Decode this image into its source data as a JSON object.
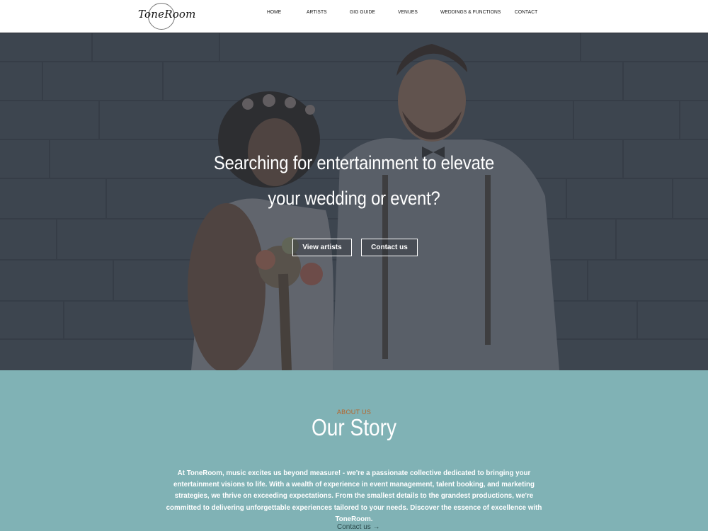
{
  "brand": {
    "logo_text": "ToneRoom"
  },
  "nav": {
    "items": [
      {
        "label": "HOME",
        "icon": ""
      },
      {
        "label": "ARTISTS"
      },
      {
        "label": "GIG GUIDE"
      },
      {
        "label": "VENUES"
      },
      {
        "label": "WEDDINGS & FUNCTIONS"
      },
      {
        "label": "CONTACT"
      }
    ]
  },
  "hero": {
    "title_line1": "Searching for entertainment to elevate",
    "title_line2": "your wedding or event?",
    "buttons": {
      "view_artists": "View artists",
      "contact_us": "Contact us"
    }
  },
  "about": {
    "eyebrow": "ABOUT US",
    "title": "Our Story",
    "body": "At ToneRoom, music excites us beyond measure! - we're a passionate collective dedicated to bringing your entertainment visions to life. With a wealth of experience in event management, talent booking, and marketing strategies, we thrive on exceeding expectations. From the smallest details to the grandest productions, we're committed to delivering unforgettable experiences tailored to your needs. Discover the essence of excellence with ToneRoom.",
    "contact_link": "Contact us →"
  },
  "colors": {
    "about_bg": "#80b2b5",
    "eyebrow": "#b5652c",
    "hero_overlay": "#2f3640"
  }
}
